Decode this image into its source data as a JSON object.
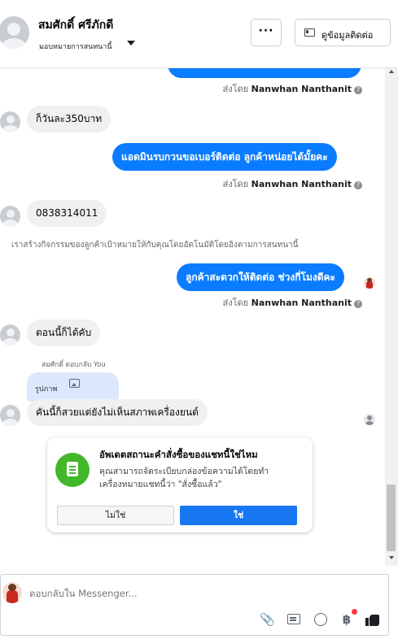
{
  "header": {
    "contact_name": "สมศักดิ์ ศรีภักดี",
    "assign_label": "มอบหมายการสนทนานี้",
    "more_label": "···",
    "contact_info_label": "ดูข้อมูลติดต่อ"
  },
  "messages": [
    {
      "direction": "out",
      "text": "",
      "sent_by_prefix": "ส่งโดย",
      "sent_by": "Nanwhan Nanthanit"
    },
    {
      "direction": "in",
      "text": "ก็วันละ350บาท"
    },
    {
      "direction": "out",
      "text": "แอดมินรบกวนขอเบอร์ติดต่อ ลูกค้าหน่อยได้มั้ยคะ",
      "sent_by_prefix": "ส่งโดย",
      "sent_by": "Nanwhan Nanthanit"
    },
    {
      "direction": "in",
      "text": "0838314011"
    },
    {
      "direction": "out",
      "text": "ลูกค้าสะดวกให้ติดต่อ ช่วงกี่โมงดีคะ",
      "sent_by_prefix": "ส่งโดย",
      "sent_by": "Nanwhan Nanthanit"
    },
    {
      "direction": "in",
      "text": "ตอนนี้ก็ได้คับ"
    },
    {
      "direction": "in",
      "text": "คันนี้ก็สวยแต่ยังไม่เห็นสภาพเครื่องยนต์"
    }
  ],
  "system_note": "เราสร้างกิจกรรมของลูกค้าเป้าหมายให้กับคุณโดยอัตโนมัติโดยอิงตามการสนทนานี้",
  "reply_note": "สมศักดิ์ ตอบกลับ You",
  "reply_quote": "รูปภาพ",
  "help_icon": "?",
  "status_card": {
    "title": "อัพเดตสถานะคำสั่งซื้อของแชทนี้ใช่ไหม",
    "body": "คุณสามารถจัดระเบียบกล่องข้อความได้โดยทำเครื่องหมายแชทนี้ว่า \"สั่งซื้อแล้ว\"",
    "no_label": "ไม่ใช่",
    "yes_label": "ใช่"
  },
  "composer": {
    "placeholder": "ตอบกลับใน Messenger...",
    "clip_glyph": "📎",
    "baht_glyph": "฿"
  }
}
